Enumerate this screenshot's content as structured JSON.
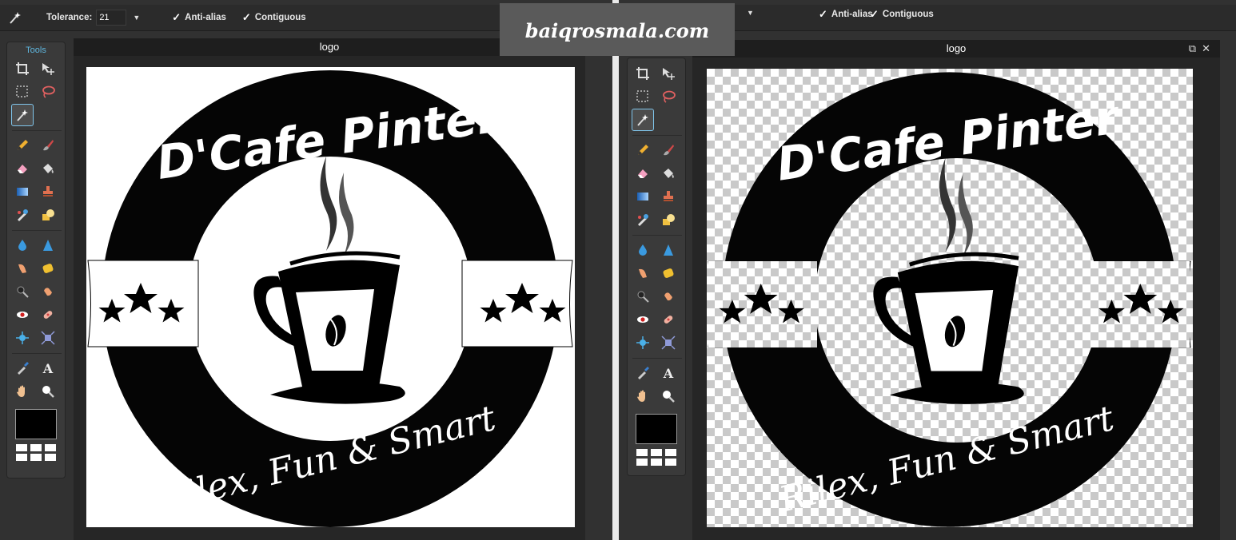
{
  "toolbar": {
    "tolerance_label": "Tolerance:",
    "tolerance_value": "21",
    "anti_alias": "Anti-alias",
    "contiguous": "Contiguous",
    "check_mark": "✓",
    "dropdown_glyph": "▼"
  },
  "tools_panel": {
    "title": "Tools"
  },
  "documents": {
    "left": {
      "title": "logo"
    },
    "right": {
      "title": "logo",
      "restore_glyph": "⧉",
      "close_glyph": "✕"
    }
  },
  "watermark": "baiqrosmala.com",
  "logo": {
    "headline": "D'Cafe Pinter",
    "tagline": "Rilex, Fun & Smart"
  },
  "colors": {
    "app_bg": "#313131",
    "title_bar": "#1e1e1e",
    "accent": "#5fb6de",
    "foreground_color": "#000000"
  },
  "tool_icons": [
    "crop-icon",
    "move-icon",
    "marquee-icon",
    "lasso-icon",
    "magic-wand-icon",
    "pencil-icon",
    "brush-icon",
    "eraser-icon",
    "bucket-icon",
    "gradient-icon",
    "stamp-icon",
    "replace-color-icon",
    "drawing-icon",
    "drop-icon",
    "sharpen-icon",
    "smudge-icon",
    "sponge-icon",
    "dodge-icon",
    "burn-icon",
    "red-eye-icon",
    "spot-heal-icon",
    "bloat-icon",
    "pinch-icon",
    "color-picker-icon",
    "type-icon",
    "hand-icon",
    "zoom-icon"
  ]
}
